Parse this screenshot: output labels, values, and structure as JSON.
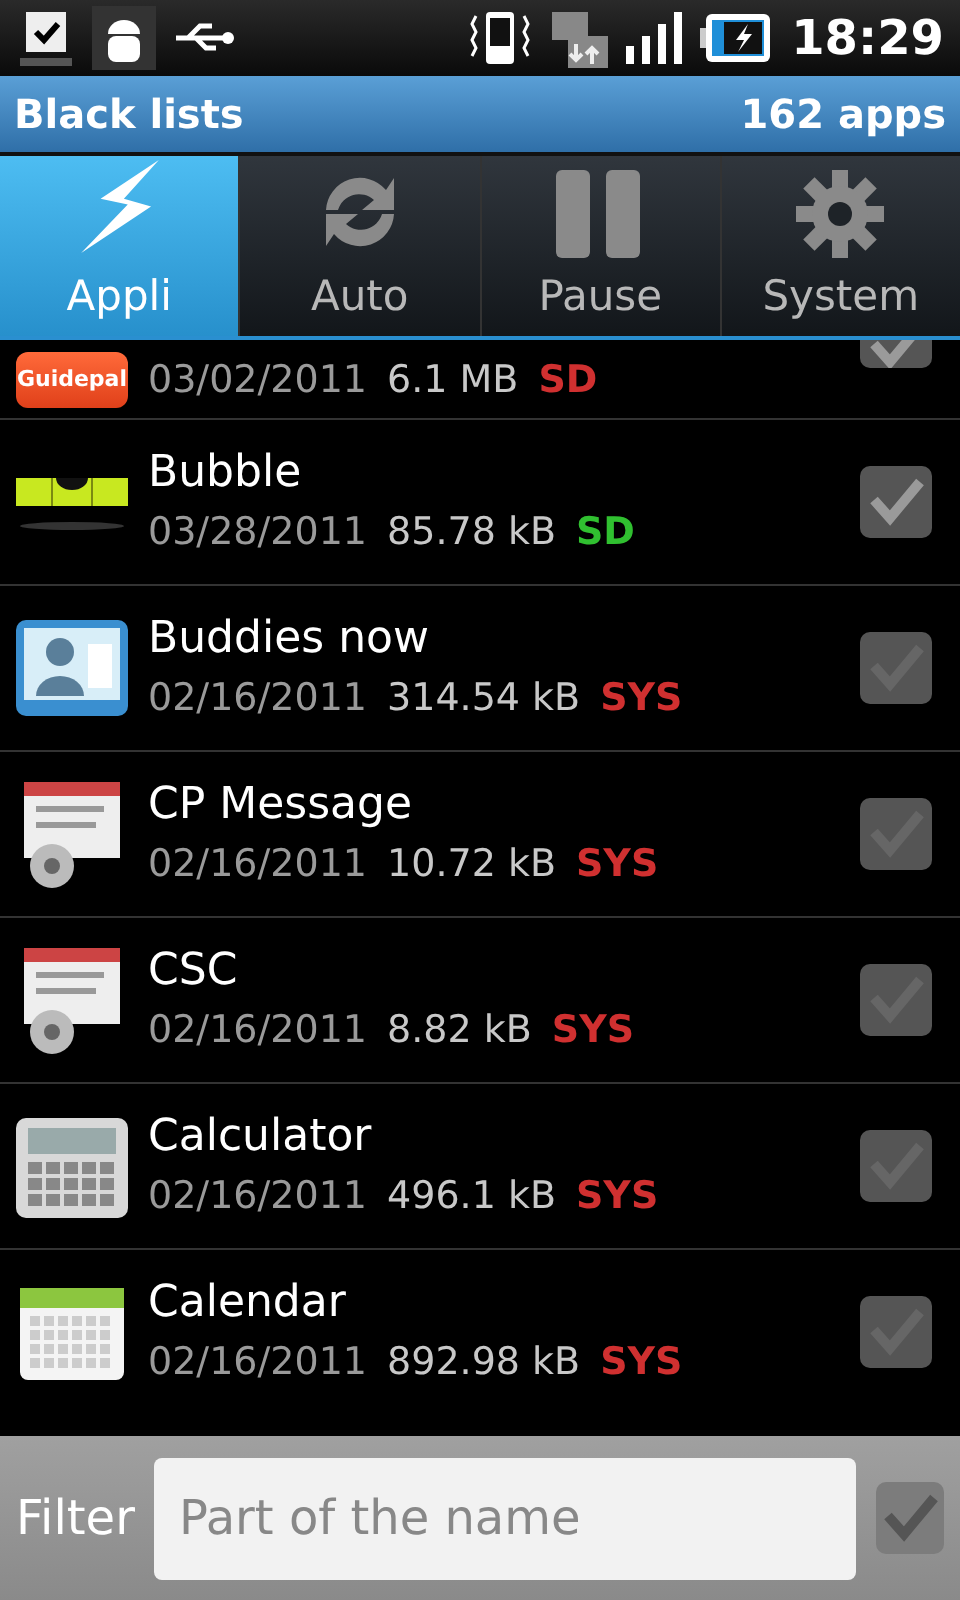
{
  "status_bar": {
    "time": "18:29"
  },
  "title_bar": {
    "title": "Black lists",
    "count": "162 apps"
  },
  "tabs": [
    {
      "label": "Appli",
      "selected": true
    },
    {
      "label": "Auto",
      "selected": false
    },
    {
      "label": "Pause",
      "selected": false
    },
    {
      "label": "System",
      "selected": false
    }
  ],
  "apps": [
    {
      "icon_label": "Guidepal",
      "date": "03/02/2011",
      "size": "6.1 MB",
      "storage": "SD",
      "color": "#d03030",
      "checked": true
    },
    {
      "name": "Bubble",
      "date": "03/28/2011",
      "size": "85.78 kB",
      "storage": "SD",
      "color": "#30c030",
      "checked": true,
      "disabled": false
    },
    {
      "name": "Buddies now",
      "date": "02/16/2011",
      "size": "314.54 kB",
      "storage": "SYS",
      "color": "#d03030",
      "checked": true,
      "disabled": true
    },
    {
      "name": "CP Message",
      "date": "02/16/2011",
      "size": "10.72 kB",
      "storage": "SYS",
      "color": "#d03030",
      "checked": true,
      "disabled": true
    },
    {
      "name": "CSC",
      "date": "02/16/2011",
      "size": "8.82 kB",
      "storage": "SYS",
      "color": "#d03030",
      "checked": true,
      "disabled": true
    },
    {
      "name": "Calculator",
      "date": "02/16/2011",
      "size": "496.1 kB",
      "storage": "SYS",
      "color": "#d03030",
      "checked": true,
      "disabled": true
    },
    {
      "name": "Calendar",
      "date": "02/16/2011",
      "size": "892.98 kB",
      "storage": "SYS",
      "color": "#d03030",
      "checked": true,
      "disabled": true
    }
  ],
  "filter": {
    "label": "Filter",
    "placeholder": "Part of the name",
    "checked": true
  }
}
